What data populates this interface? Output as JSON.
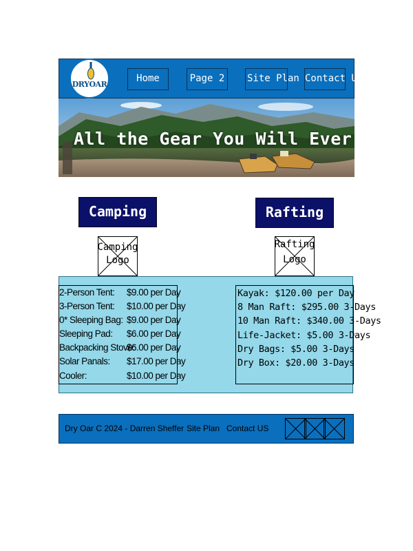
{
  "logo": {
    "text": "DRYOAR"
  },
  "nav": [
    {
      "label": "Home"
    },
    {
      "label": "Page 2"
    },
    {
      "label": "Site Plan"
    },
    {
      "label": "Contact Us"
    }
  ],
  "hero": {
    "title": "All the Gear You Will Ever"
  },
  "camping": {
    "heading": "Camping",
    "logo_placeholder": [
      "Camping",
      "Logo"
    ],
    "items": [
      {
        "name": "2-Person Tent:",
        "price": "$9.00 per Day"
      },
      {
        "name": "3-Person Tent:",
        "price": "$10.00 per Day"
      },
      {
        "name": "0* Sleeping Bag:",
        "price": "$9.00 per Day"
      },
      {
        "name": "Sleeping Pad:",
        "price": "$6.00 per Day"
      },
      {
        "name": "Backpacking Stove:",
        "price": "$6.00 per Day"
      },
      {
        "name": "Solar Panals:",
        "price": "$17.00 per Day"
      },
      {
        "name": "Cooler:",
        "price": "$10.00 per Day"
      }
    ]
  },
  "rafting": {
    "heading": "Rafting",
    "logo_placeholder": [
      "Rafting",
      "Logo"
    ],
    "items": [
      "Kayak: $120.00 per Day",
      "8 Man Raft: $295.00 3-Days",
      "10 Man Raft: $340.00 3-Days",
      "Life-Jacket: $5.00 3-Days",
      "Dry Bags: $5.00 3-Days",
      "Dry Box: $20.00 3-Days"
    ]
  },
  "footer": {
    "copyright": "Dry Oar C 2024 - Darren Sheffer",
    "site_plan": "Site Plan",
    "contact": "Contact US"
  },
  "colors": {
    "header_blue": "#0a6fbd",
    "section_button_navy": "#0b1068",
    "panel_light_blue": "#94d8ea"
  }
}
